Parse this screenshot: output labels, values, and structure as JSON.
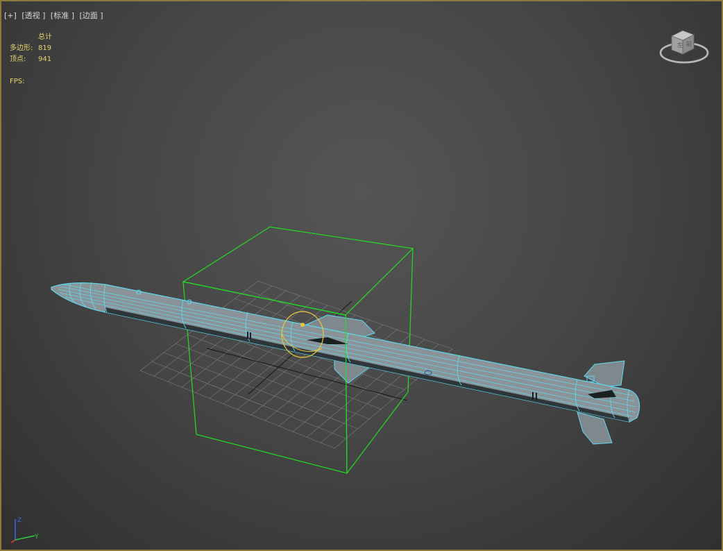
{
  "viewport": {
    "labels": [
      "[+]",
      "[透视 ]",
      "[标准 ]",
      "[边面 ]"
    ]
  },
  "stats": {
    "header": "总计",
    "polygons_label": "多边形:",
    "polygons_value": "819",
    "vertices_label": "顶点:",
    "vertices_value": "941",
    "fps_label": "FPS:"
  },
  "viewcube": {
    "icon": "viewcube-icon"
  },
  "axis_tripod": {
    "z": "Z",
    "y": "Y"
  },
  "colors": {
    "frame_border": "#8c7a3c",
    "background": "#444444",
    "selection_box": "#22dd22",
    "wireframe": "#5fd8ee",
    "mesh_fill": "#8a9398",
    "grid": "#8a8a8a",
    "rotate_gizmo": "#e8c83a",
    "stats_text": "#e6d36e"
  }
}
